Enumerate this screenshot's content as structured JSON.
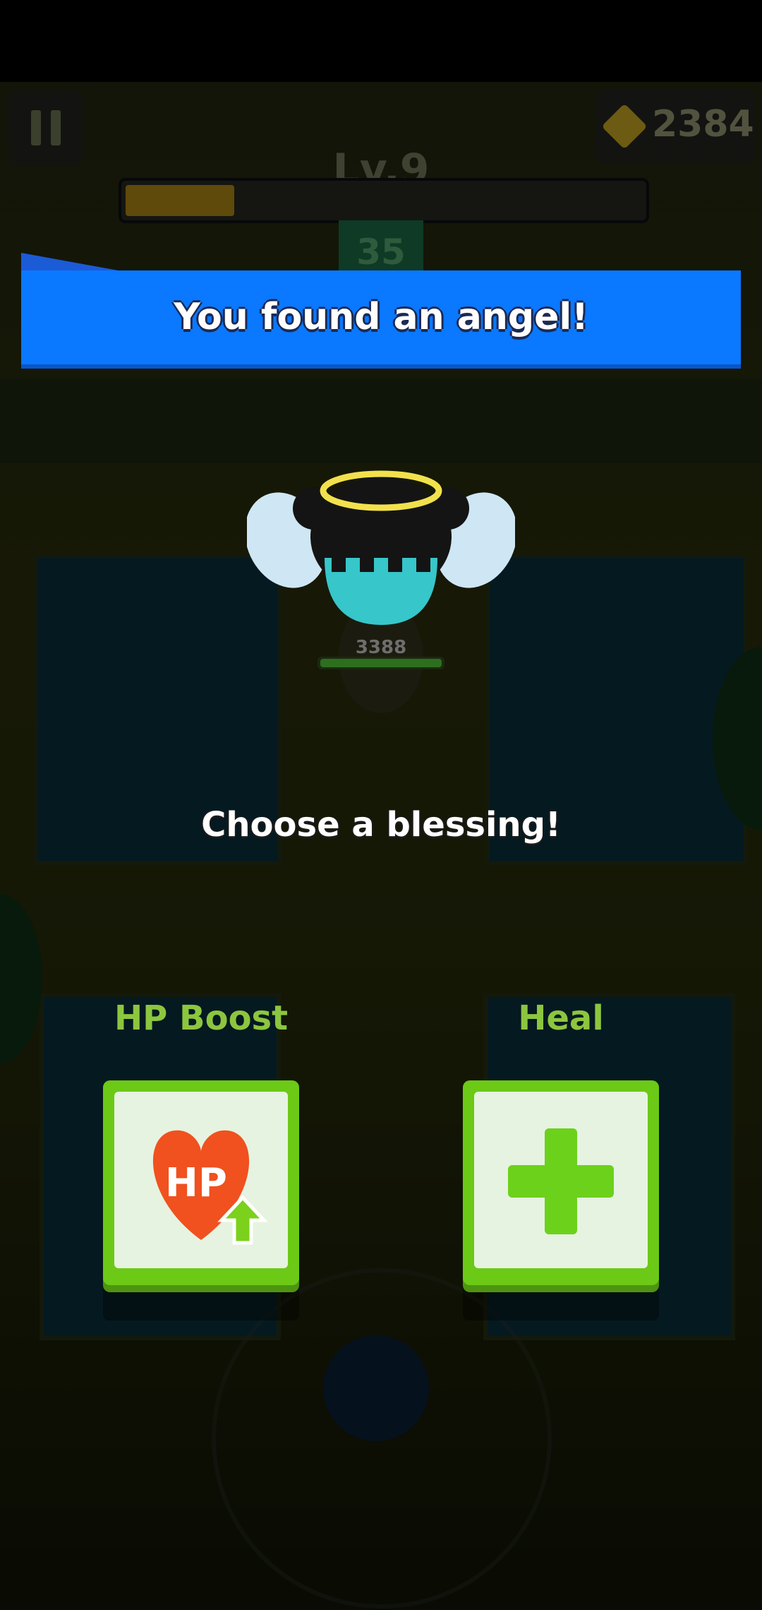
{
  "hud": {
    "gems": "2384",
    "level": "Lv.9",
    "xp_progress": 0.21,
    "room_number": "35"
  },
  "banner": {
    "title": "You found an angel!"
  },
  "scene": {
    "player_hp": "3388"
  },
  "prompt": "Choose a blessing!",
  "choices": [
    {
      "label": "HP Boost",
      "icon": "hp-boost-heart-icon",
      "icon_text": "HP"
    },
    {
      "label": "Heal",
      "icon": "green-plus-heal-icon"
    }
  ],
  "colors": {
    "banner_blue": "#0a78ff",
    "card_green": "#6cc916",
    "label_green": "#8cc63f"
  }
}
